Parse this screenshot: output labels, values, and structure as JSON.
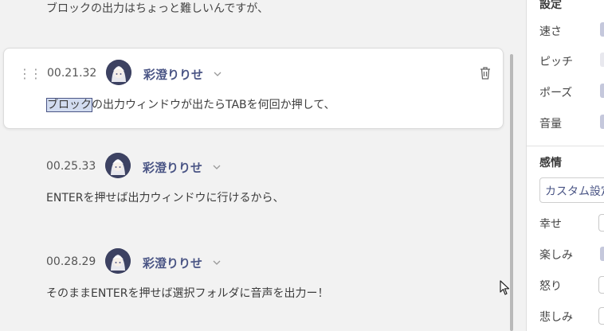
{
  "main": {
    "previous_text": "ブロックの出力はちょっと難しいんですが、",
    "blocks": [
      {
        "time": "00.21.32",
        "speaker": "彩澄りりせ",
        "text_highlight": "ブロック",
        "text_rest": "の出力ウィンドウが出たらTABを何回か押して、"
      },
      {
        "time": "00.25.33",
        "speaker": "彩澄りりせ",
        "text": "ENTERを押せば出力ウィンドウに行けるから、"
      },
      {
        "time": "00.28.29",
        "speaker": "彩澄りりせ",
        "text": "そのままENTERを押せば選択フォルダに音声を出力ー！"
      }
    ]
  },
  "sidebar": {
    "settings_title": "設定",
    "settings": [
      "速さ",
      "ピッチ",
      "ポーズ",
      "音量"
    ],
    "emotion_title": "感情",
    "emotion_select": "カスタム設定",
    "emotions": [
      "幸せ",
      "楽しみ",
      "怒り",
      "悲しみ"
    ]
  },
  "colors": {
    "accent": "#4a5585",
    "background": "#f2f2f2",
    "selection": "#d2dcf0"
  }
}
